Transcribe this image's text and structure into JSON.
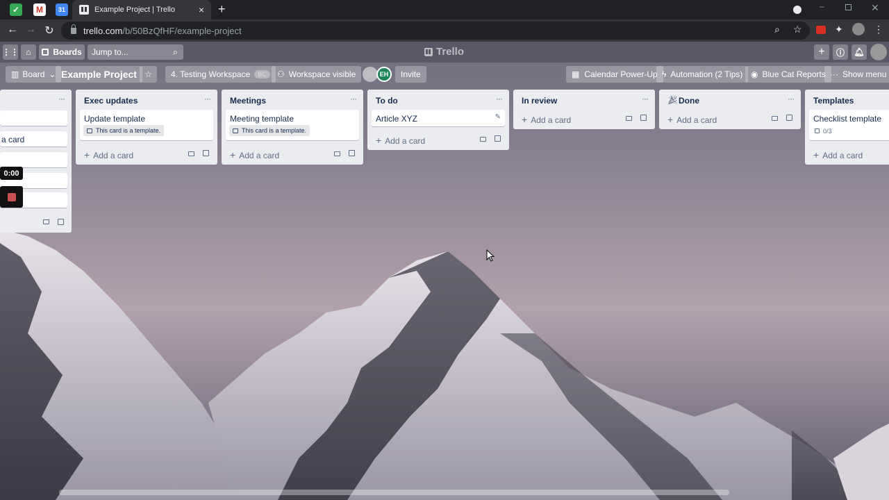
{
  "browser": {
    "tab_title": "Example Project | Trello",
    "url_host": "trello.com",
    "url_path": "/b/50BzQfHF/example-project",
    "new_tab_glyph": "+",
    "close_glyph": "×"
  },
  "header": {
    "boards_label": "Boards",
    "jump_placeholder": "Jump to...",
    "logo_text": "Trello"
  },
  "board": {
    "view_label": "Board",
    "title": "Example Project",
    "workspace_label": "4. Testing Workspace",
    "workspace_badge": "BC",
    "visibility_label": "Workspace visible",
    "member_initials": "EH",
    "invite_label": "Invite",
    "calendar_label": "Calendar Power-Up",
    "automation_label": "Automation (2 Tips)",
    "bluecat_label": "Blue Cat Reports",
    "menu_label": "Show menu"
  },
  "lists": {
    "left_partial": {
      "add_card_fragment": "a card"
    },
    "exec": {
      "title": "Exec updates",
      "card": "Update template",
      "badge": "This card is a template.",
      "add": "Add a card"
    },
    "meetings": {
      "title": "Meetings",
      "card": "Meeting template",
      "badge": "This card is a template.",
      "add": "Add a card"
    },
    "todo": {
      "title": "To do",
      "card": "Article XYZ",
      "add": "Add a card"
    },
    "review": {
      "title": "In review",
      "add": "Add a card"
    },
    "done": {
      "title": "Done",
      "add": "Add a card"
    },
    "templates": {
      "title": "Templates",
      "card": "Checklist template",
      "checklist": "0/3",
      "add": "Add a card"
    }
  },
  "recorder": {
    "timer": "0:00"
  },
  "colors": {
    "chrome_dark": "#202124",
    "chrome_toolbar": "#35363a",
    "list_bg": "#ebecf0",
    "member_green": "#1f845a"
  }
}
